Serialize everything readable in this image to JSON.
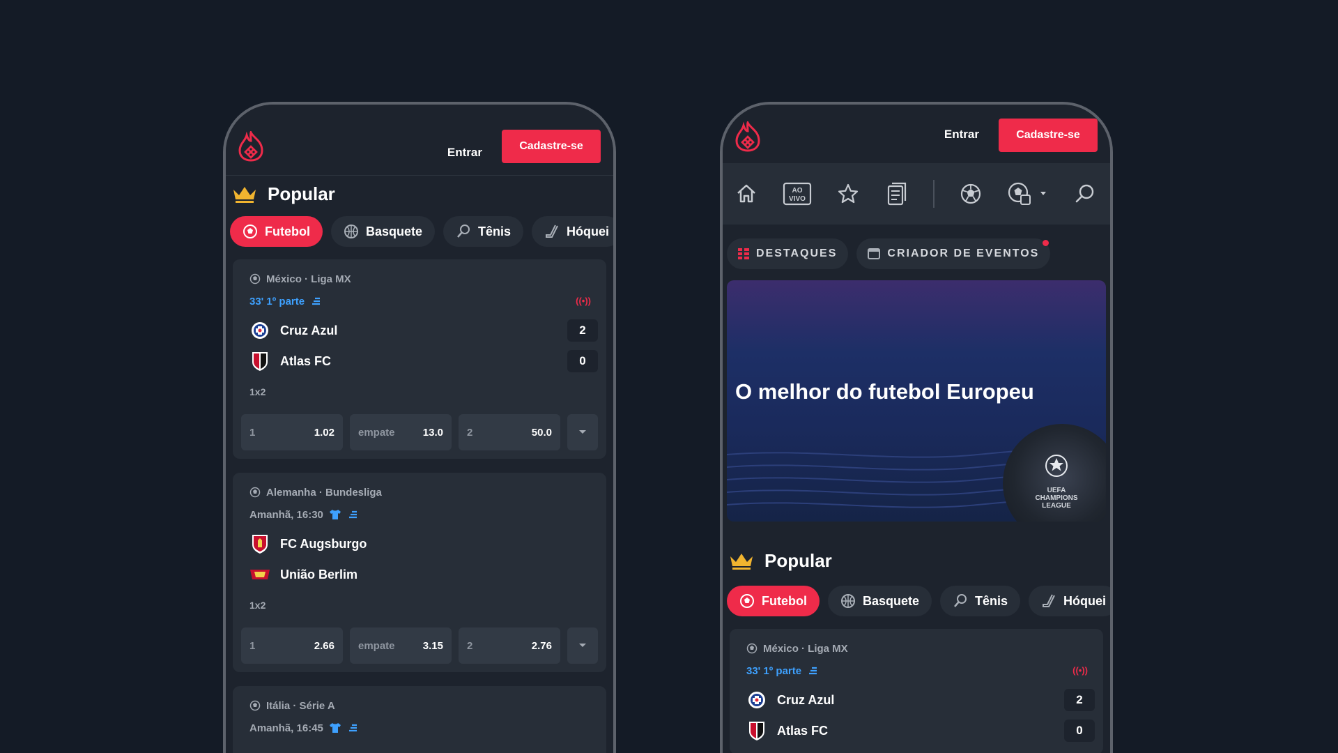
{
  "colors": {
    "background": "#141b26",
    "panel": "#1d232d",
    "card": "#272e38",
    "accent": "#ef2b4a",
    "live": "#3ea1ff"
  },
  "header": {
    "login_label": "Entrar",
    "signup_label": "Cadastre-se"
  },
  "nav": {
    "live_label": "AO\nVIVO",
    "icons": [
      "home-icon",
      "live-icon",
      "star-icon",
      "betslip-icon",
      "football-icon",
      "world-football-icon",
      "search-icon"
    ]
  },
  "sub_tabs": [
    {
      "label": "DESTAQUES"
    },
    {
      "label": "CRIADOR DE EVENTOS"
    }
  ],
  "banner": {
    "title": "O melhor do futebol Europeu",
    "logo_text": "UEFA CHAMPIONS LEAGUE"
  },
  "popular": {
    "title": "Popular"
  },
  "sports": [
    {
      "label": "Futebol"
    },
    {
      "label": "Basquete"
    },
    {
      "label": "Tênis"
    },
    {
      "label": "Hóquei"
    }
  ],
  "events": [
    {
      "league": "México · Liga MX",
      "status": "33' 1º parte",
      "live": true,
      "live_label": "((•))",
      "home": "Cruz Azul",
      "away": "Atlas FC",
      "home_score": "2",
      "away_score": "0",
      "market": "1x2",
      "odds": [
        {
          "label": "1",
          "value": "1.02"
        },
        {
          "label": "empate",
          "value": "13.0"
        },
        {
          "label": "2",
          "value": "50.0"
        }
      ]
    },
    {
      "league": "Alemanha · Bundesliga",
      "status": "Amanhã, 16:30",
      "live": false,
      "home": "FC Augsburgo",
      "away": "União Berlim",
      "market": "1x2",
      "odds": [
        {
          "label": "1",
          "value": "2.66"
        },
        {
          "label": "empate",
          "value": "3.15"
        },
        {
          "label": "2",
          "value": "2.76"
        }
      ]
    },
    {
      "league": "Itália · Série A",
      "status": "Amanhã, 16:45",
      "live": false
    }
  ]
}
